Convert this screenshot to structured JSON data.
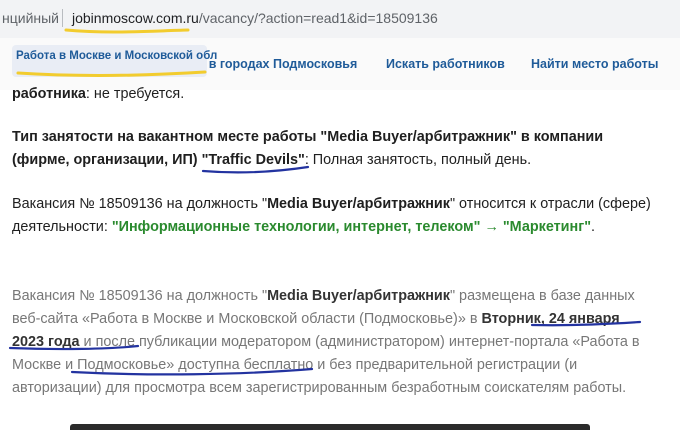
{
  "browser": {
    "security_label": "нцийный",
    "url_host": "jobinmoscow.com.ru",
    "url_path": "/vacancy/?action=read1&id=18509136"
  },
  "nav": {
    "items": [
      {
        "label": "Работа в Москве и Московской обл"
      },
      {
        "label": "Работа в городах Подмосковья"
      },
      {
        "label": "Искать работников"
      },
      {
        "label": "Найти место работы"
      }
    ]
  },
  "content": {
    "top_fragment_bold": "работника",
    "top_fragment_rest": ": не требуется.",
    "employment_bold": "Тип занятости на вакантном месте работы \"Media Buyer/арбитражник\" в компании (фирме, организации, ИП) \"Traffic Devils\"",
    "employment_rest": ": Полная занятость, полный день.",
    "vacancy_prefix": "Вакансия № 18509136 на должность \"",
    "vacancy_title": "Media Buyer/арбитражник",
    "vacancy_mid": "\" относится к отрасли (сфере) деятельности: ",
    "industry": "\"Информационные технологии, интернет, телеком\" → \"Маркетинг\"",
    "vacancy_end": ".",
    "posted_prefix": "Вакансия № 18509136 на должность \"",
    "posted_title": "Media Buyer/арбитражник",
    "posted_mid": "\" размещена в базе данных веб-сайта «Работа в Москве и Московской области (Подмосковье)» в ",
    "posted_date": "Вторник, 24 января 2023 года",
    "posted_rest": " и после публикации модератором (администратором) интернет-портала «Работа в Москве и Подмосковье» доступна бесплатно и без предварительной регистрации (и авторизации) для просмотра всем зарегистрированным безработным соискателям работы."
  }
}
